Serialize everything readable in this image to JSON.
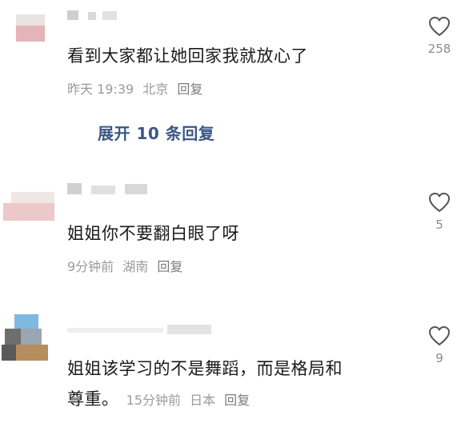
{
  "comments": [
    {
      "text": "看到大家都让她回家我就放心了",
      "time": "昨天 19:39",
      "location": "北京",
      "reply": "回复",
      "likes": "258",
      "expand": "展开 10 条回复"
    },
    {
      "text": "姐姐你不要翻白眼了呀",
      "time": "9分钟前",
      "location": "湖南",
      "reply": "回复",
      "likes": "5"
    },
    {
      "text_line1": "姐姐该学习的不是舞蹈，而是格局和",
      "text_line2": "尊重。",
      "time": "15分钟前",
      "location": "日本",
      "reply": "回复",
      "likes": "9"
    }
  ],
  "icons": {
    "like": "heart-outline-icon"
  },
  "colors": {
    "text": "#1a1a1a",
    "meta": "#9a9a9a",
    "link": "#3a5785"
  }
}
